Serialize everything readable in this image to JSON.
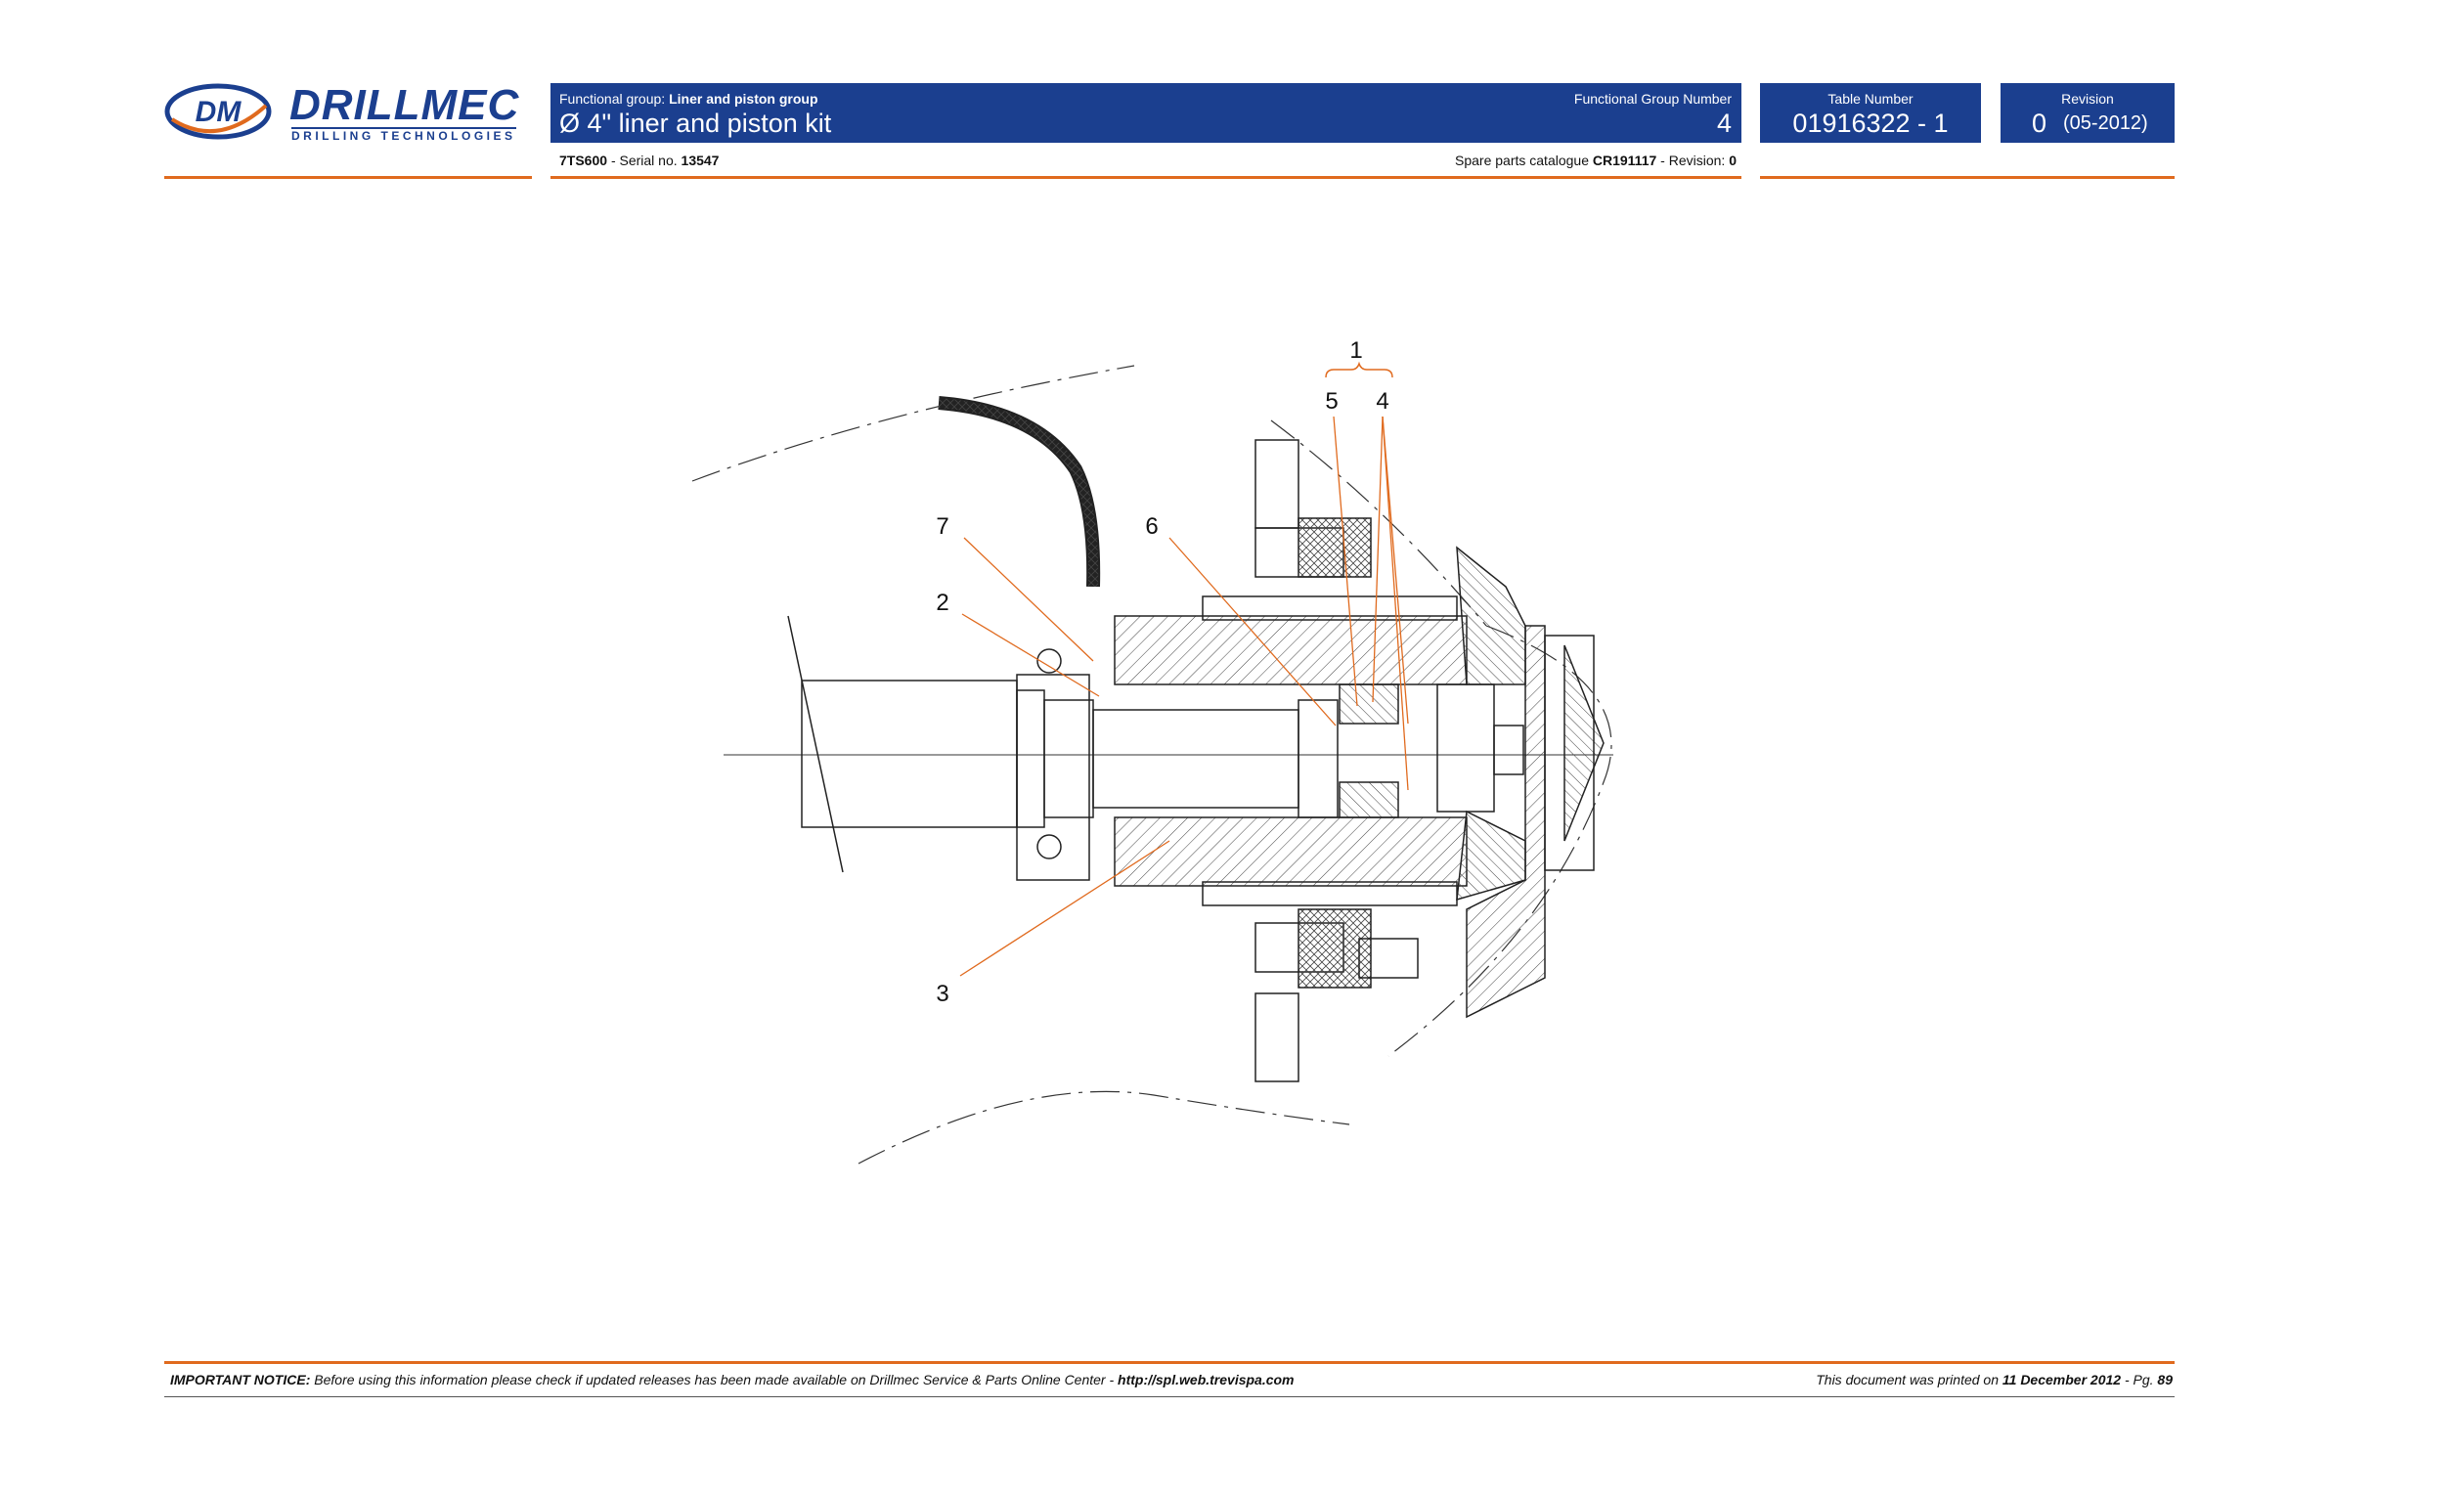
{
  "brand": {
    "name": "DRILLMEC",
    "tagline": "DRILLING TECHNOLOGIES",
    "monogram": "DM",
    "color_blue": "#1b3f8f",
    "color_orange": "#e06a1e"
  },
  "header": {
    "group_prefix": "Functional group:",
    "group_name": "Liner and piston group",
    "title": "Ø 4\" liner and piston kit",
    "fgn_label": "Functional Group Number",
    "fgn_value": "4",
    "table_label": "Table Number",
    "table_value": "01916322 - 1",
    "revision_label": "Revision",
    "revision_value": "0",
    "revision_date": "(05-2012)"
  },
  "subheader": {
    "model": "7TS600",
    "serial_prefix": "- Serial no.",
    "serial": "13547",
    "catalogue_prefix": "Spare parts catalogue",
    "catalogue": "CR191117",
    "revision_prefix": "- Revision:",
    "revision": "0"
  },
  "drawing": {
    "callouts": [
      "1",
      "5",
      "4",
      "7",
      "6",
      "2",
      "3"
    ]
  },
  "footer": {
    "notice_label": "IMPORTANT NOTICE:",
    "notice_text": "Before using this information please check if updated releases has been made available on Drillmec Service & Parts Online Center -",
    "url": "http://spl.web.trevispa.com",
    "printed_prefix": "This document was printed on",
    "printed_date": "11 December 2012",
    "page_prefix": "- Pg.",
    "page": "89"
  }
}
